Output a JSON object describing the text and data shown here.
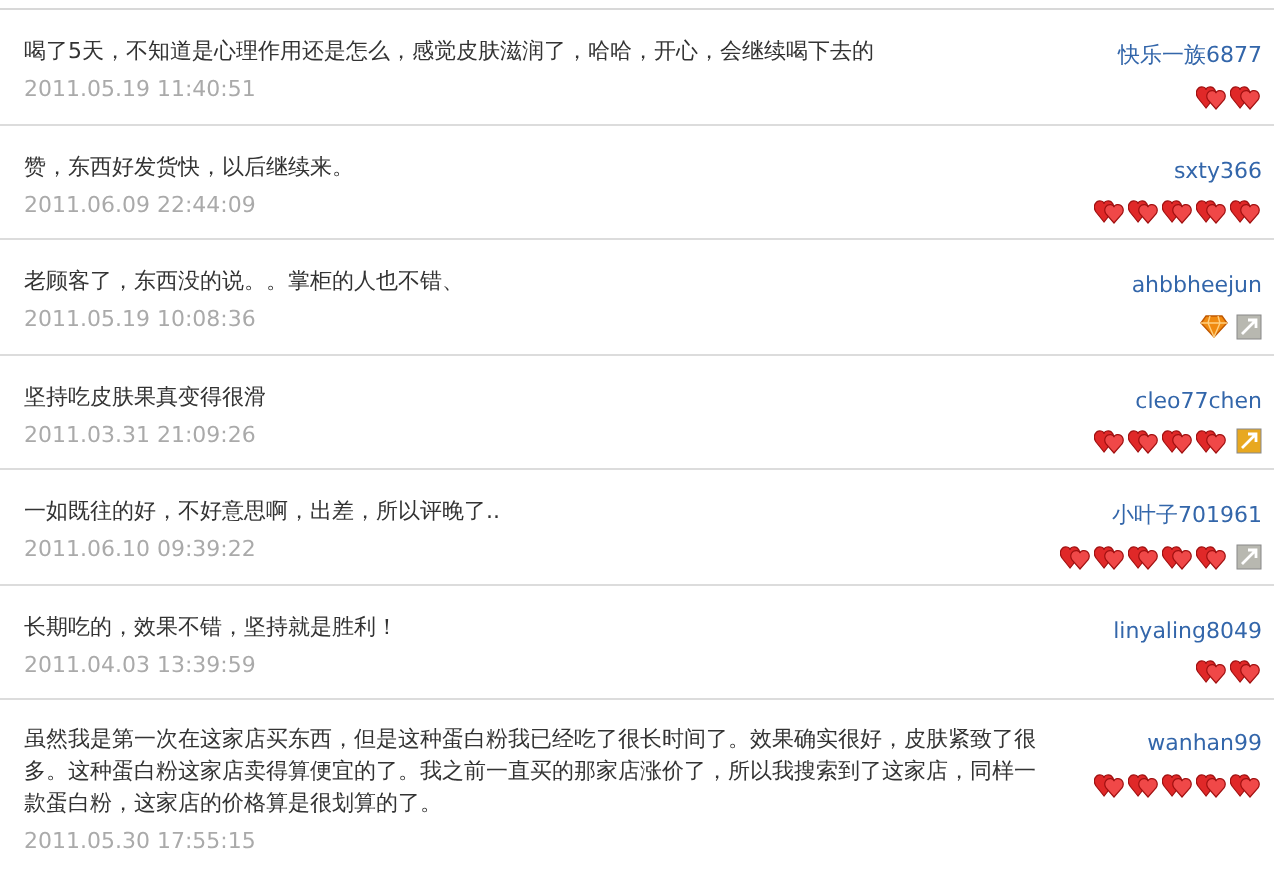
{
  "reviews": [
    {
      "comment": "喝了5天，不知道是心理作用还是怎么，感觉皮肤滋润了，哈哈，开心，会继续喝下去的",
      "time": "2011.05.19 11:40:51",
      "user": "快乐一族6877",
      "rank_icons": [
        {
          "kind": "heart"
        },
        {
          "kind": "heart"
        }
      ]
    },
    {
      "comment": "赞，东西好发货快，以后继续来。",
      "time": "2011.06.09 22:44:09",
      "user": "sxty366",
      "rank_icons": [
        {
          "kind": "heart"
        },
        {
          "kind": "heart"
        },
        {
          "kind": "heart"
        },
        {
          "kind": "heart"
        },
        {
          "kind": "heart"
        }
      ]
    },
    {
      "comment": "老顾客了，东西没的说。。掌柜的人也不错、",
      "time": "2011.05.19 10:08:36",
      "user": "ahbbheejun",
      "rank_icons": [
        {
          "kind": "diamond"
        }
      ],
      "tag": {
        "kind": "plain"
      }
    },
    {
      "comment": "坚持吃皮肤果真变得很滑",
      "time": "2011.03.31 21:09:26",
      "user": "cleo77chen",
      "rank_icons": [
        {
          "kind": "heart"
        },
        {
          "kind": "heart"
        },
        {
          "kind": "heart"
        },
        {
          "kind": "heart"
        }
      ],
      "tag": {
        "kind": "gold"
      }
    },
    {
      "comment": "一如既往的好，不好意思啊，出差，所以评晚了..",
      "time": "2011.06.10 09:39:22",
      "user": "小叶子701961",
      "rank_icons": [
        {
          "kind": "heart"
        },
        {
          "kind": "heart"
        },
        {
          "kind": "heart"
        },
        {
          "kind": "heart"
        },
        {
          "kind": "heart"
        }
      ],
      "tag": {
        "kind": "plain"
      }
    },
    {
      "comment": "长期吃的，效果不错，坚持就是胜利！",
      "time": "2011.04.03 13:39:59",
      "user": "linyaling8049",
      "rank_icons": [
        {
          "kind": "heart"
        },
        {
          "kind": "heart"
        }
      ]
    },
    {
      "comment": "虽然我是第一次在这家店买东西，但是这种蛋白粉我已经吃了很长时间了。效果确实很好，皮肤紧致了很多。这种蛋白粉这家店卖得算便宜的了。我之前一直买的那家店涨价了，所以我搜索到了这家店，同样一款蛋白粉，这家店的价格算是很划算的了。",
      "time": "2011.05.30 17:55:15",
      "user": "wanhan99",
      "rank_icons": [
        {
          "kind": "heart"
        },
        {
          "kind": "heart"
        },
        {
          "kind": "heart"
        },
        {
          "kind": "heart"
        },
        {
          "kind": "heart"
        }
      ]
    }
  ]
}
